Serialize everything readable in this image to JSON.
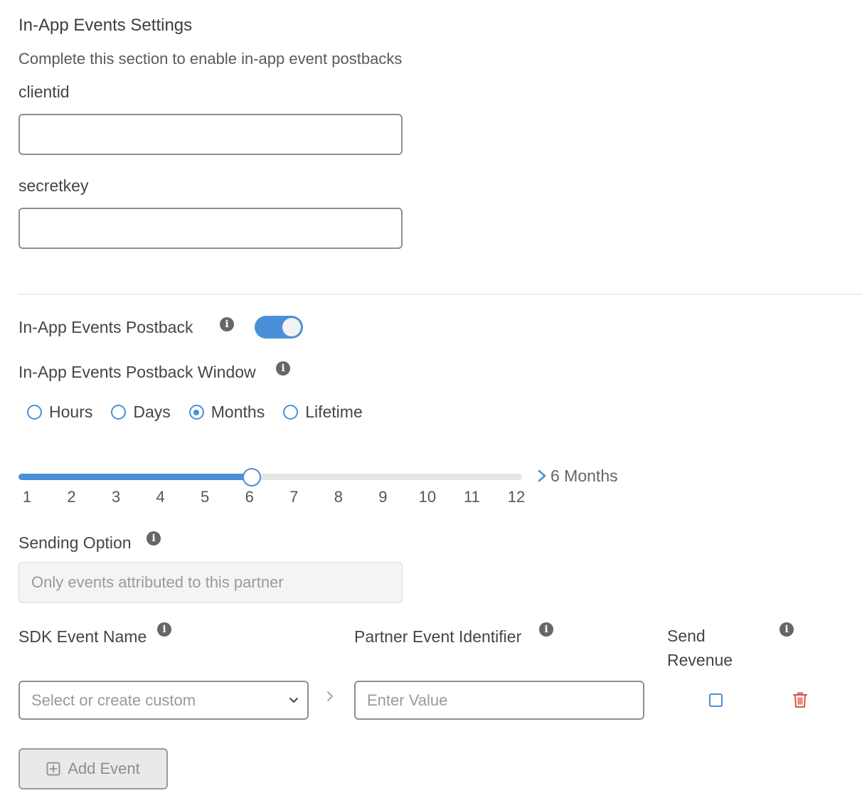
{
  "header": {
    "title": "In-App Events Settings",
    "subtitle": "Complete this section to enable in-app event postbacks"
  },
  "credentials": {
    "clientid_label": "clientid",
    "clientid_value": "",
    "secretkey_label": "secretkey",
    "secretkey_value": ""
  },
  "postback": {
    "toggle_label": "In-App Events Postback",
    "toggle_on": true,
    "window_label": "In-App Events Postback Window",
    "window_options": [
      "Hours",
      "Days",
      "Months",
      "Lifetime"
    ],
    "window_selected": "Months",
    "slider_ticks": [
      "1",
      "2",
      "3",
      "4",
      "5",
      "6",
      "7",
      "8",
      "9",
      "10",
      "11",
      "12"
    ],
    "slider_min": 1,
    "slider_max": 12,
    "slider_value": 6,
    "slider_value_text": "6 Months"
  },
  "sending": {
    "label": "Sending Option",
    "value": "Only events attributed to this partner"
  },
  "event_mapping": {
    "col_sdk_event": "SDK Event Name",
    "col_partner_event": "Partner Event Identifier",
    "col_send_revenue": "Send Revenue",
    "sdk_event_placeholder": "Select or create custom",
    "partner_event_placeholder": "Enter Value",
    "send_revenue_checked": false,
    "add_event_label": "Add Event"
  },
  "colors": {
    "accent": "#4a90d9",
    "delete": "#d9534f",
    "disabled_bg": "#f3f4f5"
  },
  "icons": {
    "info": "info-icon",
    "chevron_right": "chevron-right-icon",
    "chevron_down": "chevron-down-icon",
    "trash": "trash-icon",
    "plus_square": "plus-square-icon"
  }
}
